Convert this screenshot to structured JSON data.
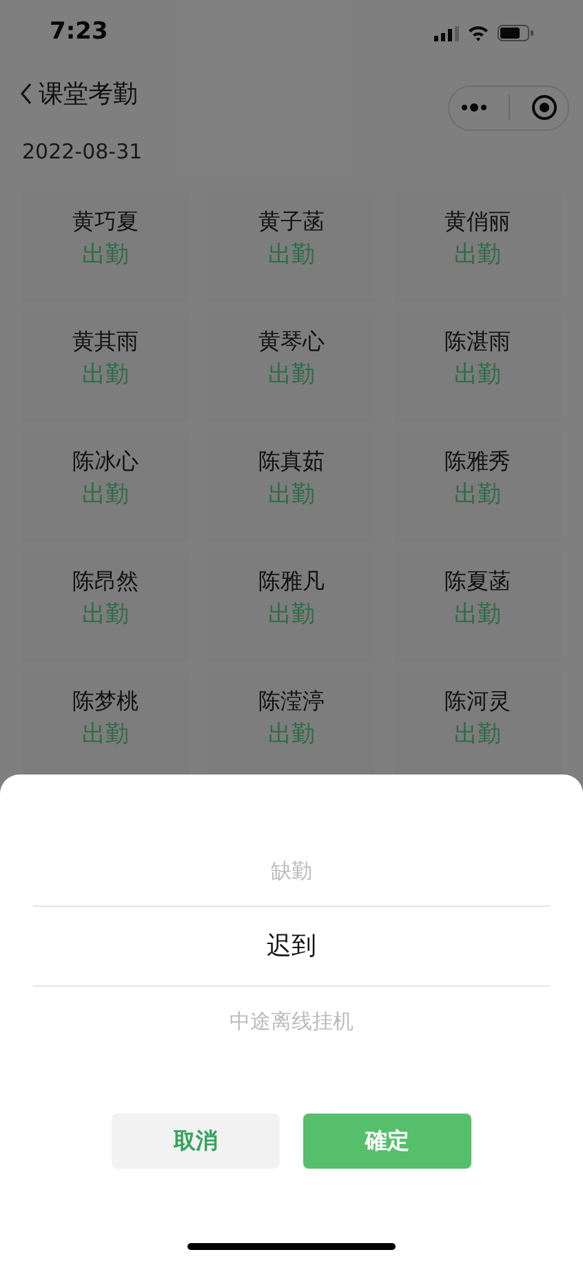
{
  "status_bar": {
    "time": "7:23"
  },
  "nav": {
    "title": "课堂考勤"
  },
  "date": "2022-08-31",
  "students": [
    {
      "name": "黄巧夏",
      "status": "出勤"
    },
    {
      "name": "黄子菡",
      "status": "出勤"
    },
    {
      "name": "黄俏丽",
      "status": "出勤"
    },
    {
      "name": "黄其雨",
      "status": "出勤"
    },
    {
      "name": "黄琴心",
      "status": "出勤"
    },
    {
      "name": "陈湛雨",
      "status": "出勤"
    },
    {
      "name": "陈冰心",
      "status": "出勤"
    },
    {
      "name": "陈真茹",
      "status": "出勤"
    },
    {
      "name": "陈雅秀",
      "status": "出勤"
    },
    {
      "name": "陈昂然",
      "status": "出勤"
    },
    {
      "name": "陈雅凡",
      "status": "出勤"
    },
    {
      "name": "陈夏菡",
      "status": "出勤"
    },
    {
      "name": "陈梦桃",
      "status": "出勤"
    },
    {
      "name": "陈滢渟",
      "status": "出勤"
    },
    {
      "name": "陈河灵",
      "status": "出勤"
    }
  ],
  "picker": {
    "options": [
      {
        "label": "缺勤",
        "selected": false
      },
      {
        "label": "迟到",
        "selected": true
      },
      {
        "label": "中途离线挂机",
        "selected": false
      }
    ],
    "buttons": [
      {
        "label": "取消",
        "kind": "cancel"
      },
      {
        "label": "確定",
        "kind": "confirm"
      }
    ]
  }
}
